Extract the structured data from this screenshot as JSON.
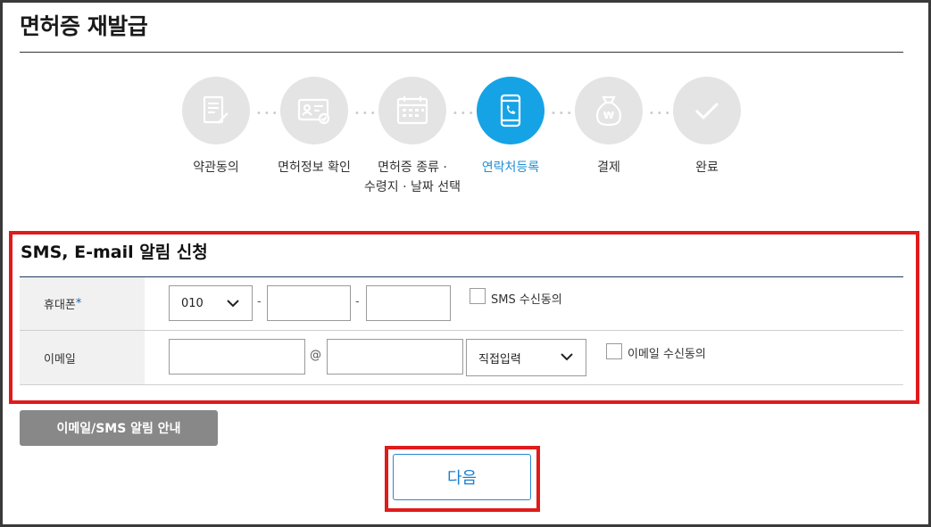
{
  "page": {
    "title": "면허증 재발급"
  },
  "steps": [
    {
      "label": "약관동의",
      "icon": "document-pen-icon",
      "active": false
    },
    {
      "label": "면허정보 확인",
      "icon": "id-card-check-icon",
      "active": false
    },
    {
      "label": "면허증 종류 ·\n수령지 · 날짜 선택",
      "icon": "calendar-icon",
      "active": false
    },
    {
      "label": "연락처등록",
      "icon": "phone-icon",
      "active": true
    },
    {
      "label": "결제",
      "icon": "won-bag-icon",
      "active": false
    },
    {
      "label": "완료",
      "icon": "checkmark-icon",
      "active": false
    }
  ],
  "form": {
    "title": "SMS, E-mail 알림 신청",
    "phone": {
      "label": "휴대폰",
      "required_mark": "*",
      "prefix": "010",
      "separator": "-",
      "middle": "",
      "last": "",
      "consent_label": "SMS 수신동의",
      "consent_checked": false
    },
    "email": {
      "label": "이메일",
      "local": "",
      "at": "@",
      "domain": "",
      "domain_select": "직접입력",
      "consent_label": "이메일 수신동의",
      "consent_checked": false
    }
  },
  "buttons": {
    "info": "이메일/SMS 알림 안내",
    "next": "다음"
  },
  "colors": {
    "active_step": "#15a3e6",
    "inactive_step": "#e4e4e4",
    "highlight": "#e01b1b",
    "next_text": "#1a7fd0"
  }
}
